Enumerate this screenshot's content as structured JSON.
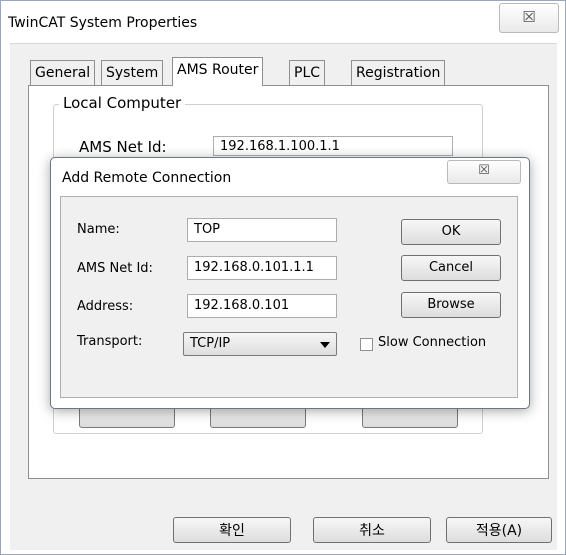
{
  "window": {
    "title": "TwinCAT System Properties",
    "close_glyph": "☒"
  },
  "tabs": [
    {
      "label": "General"
    },
    {
      "label": "System"
    },
    {
      "label": "AMS Router"
    },
    {
      "label": "PLC"
    },
    {
      "label": "Registration"
    }
  ],
  "active_tab": "AMS Router",
  "local_computer": {
    "group_label": "Local Computer",
    "net_id_label": "AMS Net Id:",
    "net_id_value": "192.168.1.100.1.1"
  },
  "footer": {
    "ok": "확인",
    "cancel": "취소",
    "apply": "적용(A)"
  },
  "dialog": {
    "title": "Add Remote Connection",
    "close_glyph": "☒",
    "name_label": "Name:",
    "name_value": "TOP",
    "netid_label": "AMS Net Id:",
    "netid_value": "192.168.0.101.1.1",
    "address_label": "Address:",
    "address_value": "192.168.0.101",
    "transport_label": "Transport:",
    "transport_value": "TCP/IP",
    "slow_label": "Slow Connection",
    "slow_checked": false,
    "ok": "OK",
    "cancel": "Cancel",
    "browse": "Browse"
  }
}
